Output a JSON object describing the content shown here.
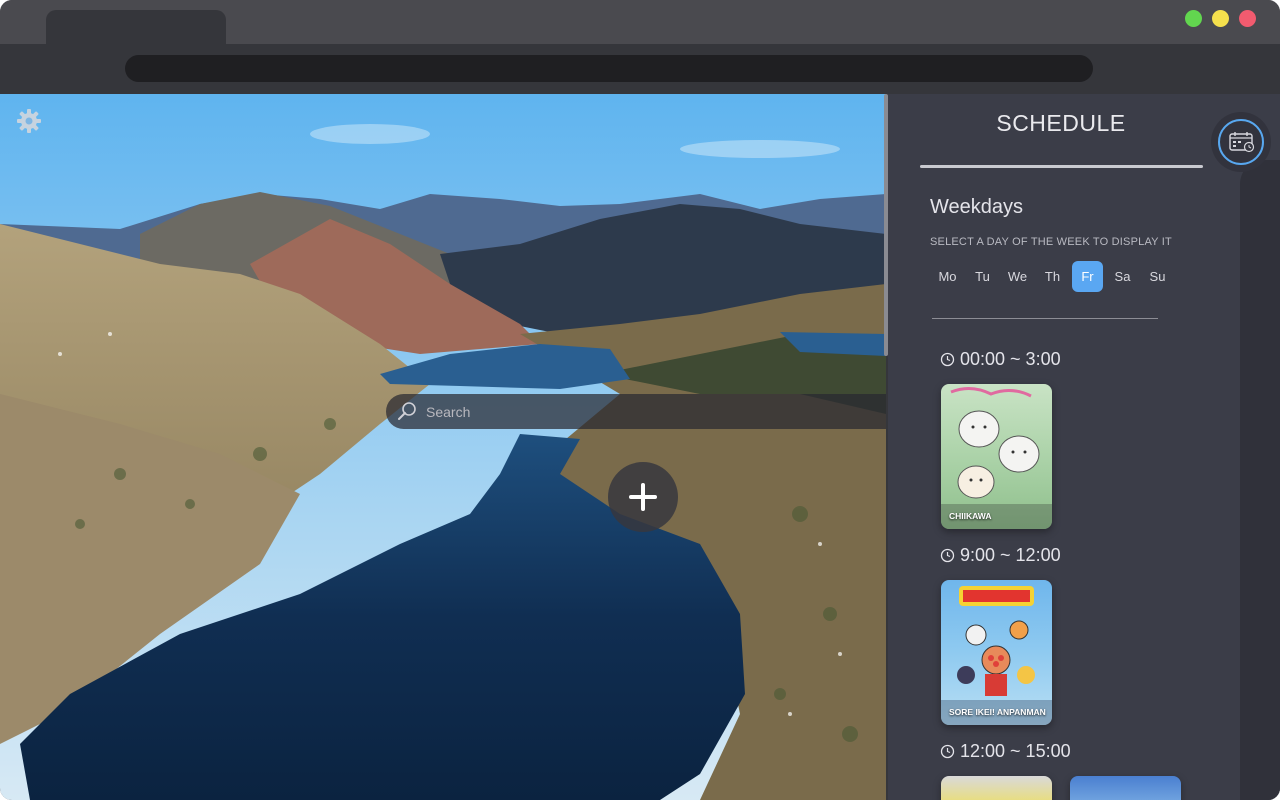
{
  "browser": {
    "traffic_lights": [
      {
        "name": "maximize",
        "color": "#62d64f"
      },
      {
        "name": "minimize",
        "color": "#f5e04d"
      },
      {
        "name": "close",
        "color": "#f25b6f"
      }
    ]
  },
  "background": {
    "settings_icon": "gear-icon",
    "search": {
      "placeholder": "Search",
      "icon": "search-icon"
    },
    "add_button": {
      "icon": "plus-icon"
    }
  },
  "schedule": {
    "title": "SCHEDULE",
    "toggle_icon": "calendar-icon",
    "weekdays_title": "Weekdays",
    "hint": "SELECT A DAY OF THE WEEK TO DISPLAY IT",
    "days": [
      "Mo",
      "Tu",
      "We",
      "Th",
      "Fr",
      "Sa",
      "Su"
    ],
    "selected_day": "Fr",
    "accent_color": "#5aa7f2",
    "slots": [
      {
        "time": "00:00 ~ 3:00",
        "items": [
          {
            "title": "CHIIKAWA"
          }
        ]
      },
      {
        "time": "9:00 ~ 12:00",
        "items": [
          {
            "title": "SORE IKEI! ANPANMAN"
          }
        ]
      },
      {
        "time": "12:00 ~ 15:00",
        "items": []
      }
    ]
  }
}
